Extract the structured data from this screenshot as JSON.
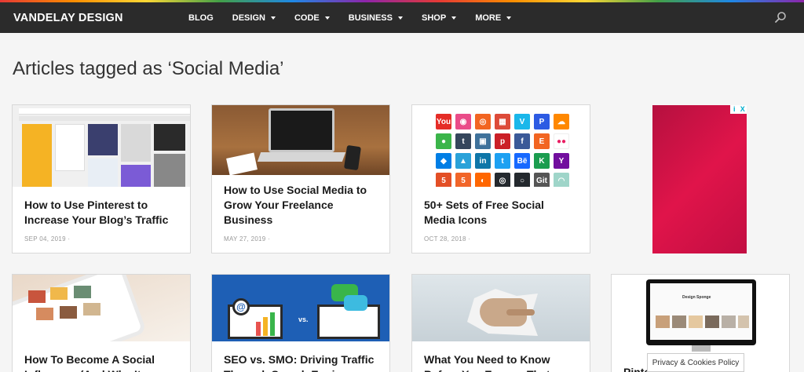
{
  "header": {
    "logo": "VANDELAY DESIGN",
    "nav": [
      {
        "label": "BLOG",
        "dropdown": false
      },
      {
        "label": "DESIGN",
        "dropdown": true
      },
      {
        "label": "CODE",
        "dropdown": true
      },
      {
        "label": "BUSINESS",
        "dropdown": true
      },
      {
        "label": "SHOP",
        "dropdown": true
      },
      {
        "label": "MORE",
        "dropdown": true
      }
    ],
    "search_icon": "search-icon"
  },
  "page": {
    "title": "Articles tagged as ‘Social Media’"
  },
  "cards": [
    {
      "title": "How to Use Pinterest to Increase Your Blog’s Traffic",
      "date": "SEP 04, 2019 ·"
    },
    {
      "title": "How to Use Social Media to Grow Your Freelance Business",
      "date": "MAY 27, 2019 ·"
    },
    {
      "title": "50+ Sets of Free Social Media Icons",
      "date": "OCT 28, 2018 ·"
    },
    {
      "title": "How To Become A Social Influencer (And Why It",
      "date": ""
    },
    {
      "title": "SEO vs. SMO: Driving Traffic Through Search Engines",
      "date": ""
    },
    {
      "title": "What You Need to Know Before You Expose That",
      "date": ""
    },
    {
      "title": "Pinterest",
      "date": ""
    }
  ],
  "thumb_texts": {
    "icons": [
      "You",
      "◉",
      "◎",
      "▦",
      "V",
      "P",
      "☁",
      "●",
      "t",
      "▣",
      "p",
      "f",
      "E",
      "●●",
      "◆",
      "▲",
      "in",
      "t",
      "Bë",
      "K",
      "Y",
      "5",
      "5",
      "◐",
      "◎",
      "○",
      "Git",
      "◠"
    ],
    "icon_colors": [
      "#e52d27",
      "#ea4c89",
      "#f26522",
      "#dd4b39",
      "#1ab7ea",
      "#2d5be3",
      "#ff8800",
      "#3bb54a",
      "#35465c",
      "#3f729b",
      "#cb2027",
      "#3b5998",
      "#f26522",
      "#ffffff",
      "#007ee5",
      "#2aa2d9",
      "#0e76a8",
      "#1da1f2",
      "#1769ff",
      "#1b9d4f",
      "#720e9e",
      "#e34f26",
      "#f16529",
      "#ff6600",
      "#24292e",
      "#24292e",
      "#555555",
      "#9fd5c9"
    ],
    "seo_vs": "vs.",
    "pinterest_screen_title": "Design Sponge"
  },
  "ad": {
    "badge_info": "i",
    "badge_close": "X"
  },
  "privacy": {
    "label": "Privacy & Cookies Policy"
  }
}
